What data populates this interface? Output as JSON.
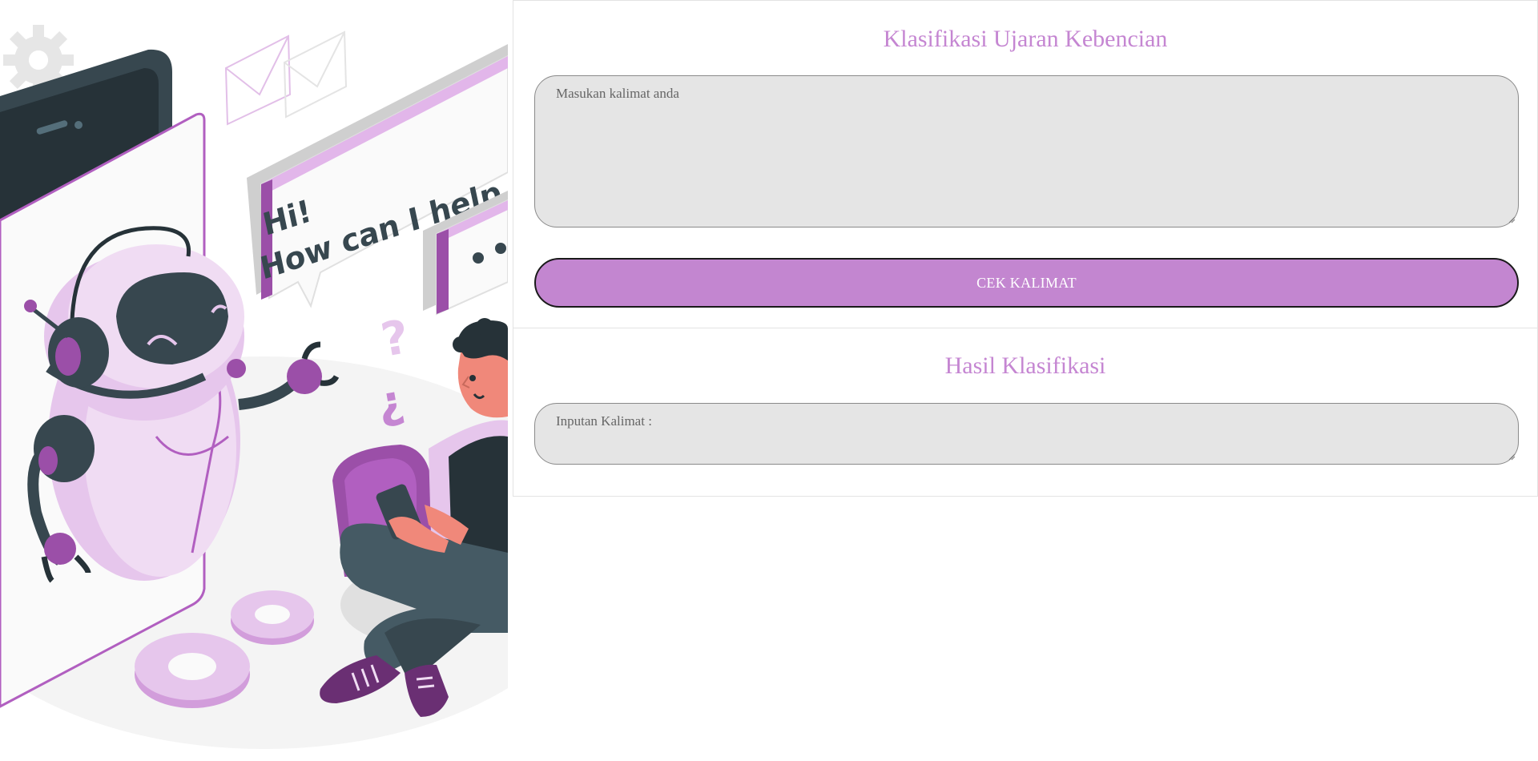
{
  "illustration": {
    "bubble_line1": "Hi!",
    "bubble_line2": "How can I help you?",
    "colors": {
      "purple_dark": "#9b4fa8",
      "purple_mid": "#c586d2",
      "purple_light": "#e6c6ec",
      "charcoal": "#37474f",
      "skin": "#f0887a"
    }
  },
  "form": {
    "title": "Klasifikasi Ujaran Kebencian",
    "input_placeholder": "Masukan kalimat anda",
    "input_value": "",
    "submit_label": "CEK KALIMAT"
  },
  "result": {
    "title": "Hasil Klasifikasi",
    "output_placeholder": "Inputan Kalimat :"
  },
  "colors": {
    "accent": "#c586d2",
    "button_bg": "#c386d0",
    "field_bg": "#e5e5e5"
  }
}
